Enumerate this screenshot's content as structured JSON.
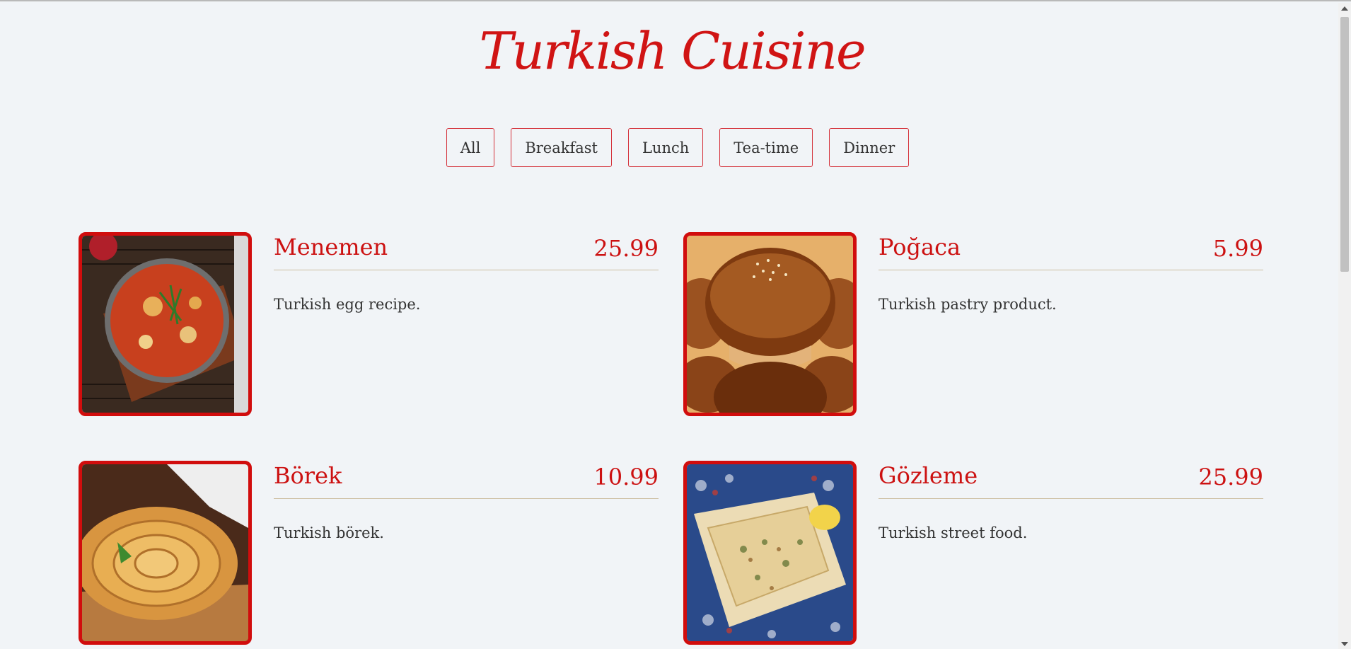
{
  "page_title": "Turkish Cuisine",
  "filters": [
    "All",
    "Breakfast",
    "Lunch",
    "Tea-time",
    "Dinner"
  ],
  "menu": [
    {
      "name": "Menemen",
      "price": "25.99",
      "desc": "Turkish egg recipe.",
      "image_icon": "menemen-dish-image"
    },
    {
      "name": "Poğaca",
      "price": "5.99",
      "desc": "Turkish pastry product.",
      "image_icon": "pogaca-pastry-image"
    },
    {
      "name": "Börek",
      "price": "10.99",
      "desc": "Turkish börek.",
      "image_icon": "borek-pastry-image"
    },
    {
      "name": "Gözleme",
      "price": "25.99",
      "desc": "Turkish street food.",
      "image_icon": "gozleme-flatbread-image"
    }
  ],
  "colors": {
    "accent": "#d01414",
    "background": "#f1f4f7",
    "divider": "#cbbd9f"
  }
}
